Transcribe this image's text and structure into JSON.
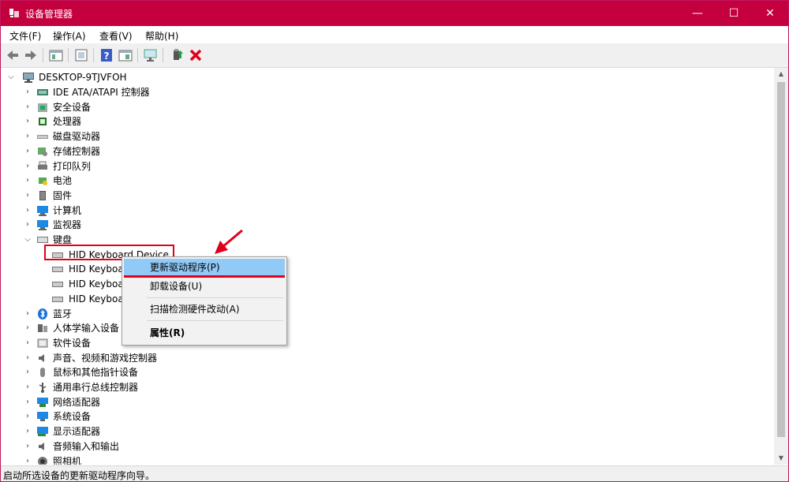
{
  "window": {
    "title": "设备管理器",
    "accent_color": "#c4003f",
    "minimize_icon": "—",
    "maximize_icon": "☐",
    "close_icon": "✕"
  },
  "menu": [
    "文件(F)",
    "操作(A)",
    "查看(V)",
    "帮助(H)"
  ],
  "toolbar": [
    "back-icon",
    "forward-icon",
    "properties-pane-icon",
    "show-hide-icon",
    "help-icon",
    "show-devices-icon",
    "scan-hardware-icon",
    "update-driver-icon",
    "uninstall-icon"
  ],
  "tree": {
    "root": "DESKTOP-9TJVFOH",
    "items": [
      {
        "label": "IDE ATA/ATAPI 控制器",
        "icon": "ide-controller-icon"
      },
      {
        "label": "安全设备",
        "icon": "security-device-icon"
      },
      {
        "label": "处理器",
        "icon": "processor-icon"
      },
      {
        "label": "磁盘驱动器",
        "icon": "disk-drive-icon"
      },
      {
        "label": "存储控制器",
        "icon": "storage-controller-icon"
      },
      {
        "label": "打印队列",
        "icon": "print-queue-icon"
      },
      {
        "label": "电池",
        "icon": "battery-icon"
      },
      {
        "label": "固件",
        "icon": "firmware-icon"
      },
      {
        "label": "计算机",
        "icon": "computer-icon"
      },
      {
        "label": "监视器",
        "icon": "monitor-icon"
      },
      {
        "label": "键盘",
        "icon": "keyboard-icon",
        "expanded": true,
        "children": [
          "HID Keyboard Device",
          "HID Keyboa",
          "HID Keyboa",
          "HID Keyboa"
        ]
      },
      {
        "label": "蓝牙",
        "icon": "bluetooth-icon"
      },
      {
        "label": "人体学输入设备",
        "icon": "hid-icon"
      },
      {
        "label": "软件设备",
        "icon": "software-device-icon"
      },
      {
        "label": "声音、视频和游戏控制器",
        "icon": "sound-icon"
      },
      {
        "label": "鼠标和其他指针设备",
        "icon": "mouse-icon"
      },
      {
        "label": "通用串行总线控制器",
        "icon": "usb-icon"
      },
      {
        "label": "网络适配器",
        "icon": "network-adapter-icon"
      },
      {
        "label": "系统设备",
        "icon": "system-device-icon"
      },
      {
        "label": "显示适配器",
        "icon": "display-adapter-icon"
      },
      {
        "label": "音频输入和输出",
        "icon": "audio-io-icon"
      },
      {
        "label": "照相机",
        "icon": "camera-icon"
      }
    ]
  },
  "context_menu": {
    "items": [
      "更新驱动程序(P)",
      "卸载设备(U)",
      "扫描检测硬件改动(A)",
      "属性(R)"
    ],
    "selected": "更新驱动程序(P)"
  },
  "status": "启动所选设备的更新驱动程序向导。",
  "annotation_color": "#e0001b"
}
